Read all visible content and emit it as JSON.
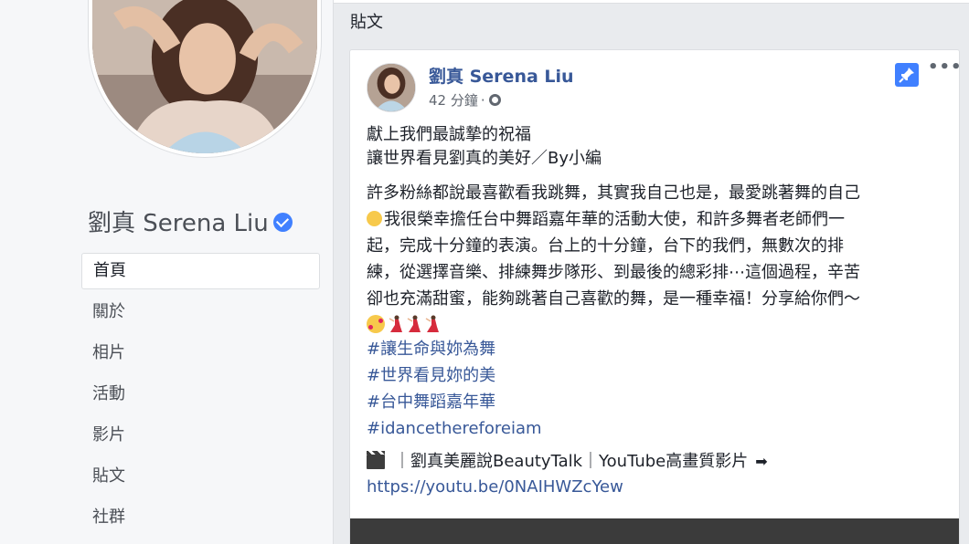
{
  "sidebar": {
    "page_name": "劉真 Serena Liu",
    "nav": [
      {
        "label": "首頁",
        "active": true
      },
      {
        "label": "關於"
      },
      {
        "label": "相片"
      },
      {
        "label": "活動"
      },
      {
        "label": "影片"
      },
      {
        "label": "貼文"
      },
      {
        "label": "社群"
      }
    ]
  },
  "main": {
    "section_title": "貼文",
    "post": {
      "author": "劉真 Serena Liu",
      "time": "42 分鐘",
      "time_separator": "·",
      "privacy_icon": "globe-icon",
      "pinned_icon": "pin-icon",
      "more_icon": "more-icon",
      "more_label": "•••",
      "intro_line1": "獻上我們最誠摯的祝福",
      "intro_line2": "讓世界看見劉真的美好／By小編",
      "para_line1": "許多粉絲都說最喜歡看我跳舞，其實我自己也是，最愛跳著舞的自己",
      "para_line2": "我很榮幸擔任台中舞蹈嘉年華的活動大使，和許多舞者老師們一",
      "para_line3": "起，完成十分鐘的表演。台上的十分鐘，台下的我們，無數次的排",
      "para_line4": "練，從選擇音樂、排練舞步隊形、到最後的總彩排⋯這個過程，辛苦",
      "para_line5": "卻也充滿甜蜜，能夠跳著自己喜歡的舞，是一種幸福！分享給你們～",
      "hashtags": [
        "#讓生命與妳為舞",
        "#世界看見妳的美",
        "#台中舞蹈嘉年華",
        "#idancethereforeiam"
      ],
      "link_title": "｜劉真美麗說BeautyTalk｜YouTube高畫質影片",
      "link_arrow": "➡",
      "link_url": "https://youtu.be/0NAIHWZcYew"
    }
  },
  "colors": {
    "link": "#385898",
    "background": "#e9ebee",
    "accent": "#4080ff"
  }
}
